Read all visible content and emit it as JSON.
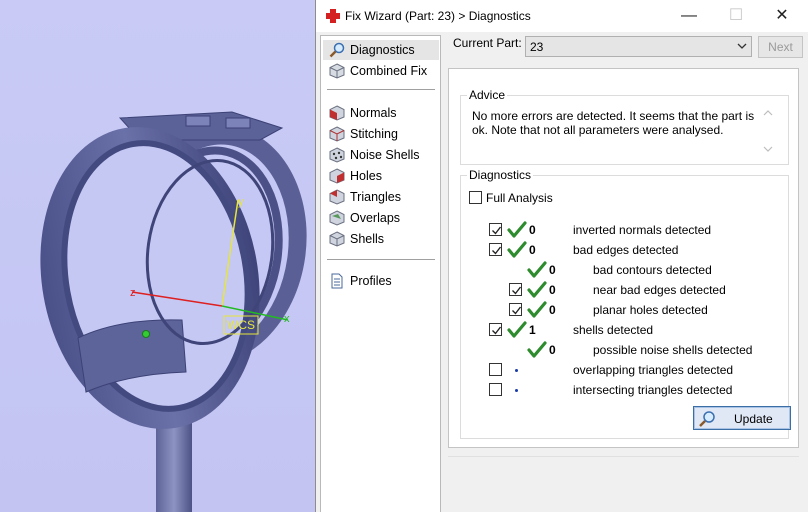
{
  "window": {
    "title": "Fix Wizard (Part: 23) > Diagnostics",
    "minimize": "—",
    "maximize": "☐",
    "close": "✕"
  },
  "nav": {
    "items": [
      {
        "label": "Diagnostics",
        "icon": "magnifier-icon",
        "selected": true
      },
      {
        "label": "Combined Fix",
        "icon": "cube-icon"
      },
      {
        "label": "Normals",
        "icon": "normals-cube-icon"
      },
      {
        "label": "Stitching",
        "icon": "stitching-cube-icon"
      },
      {
        "label": "Noise Shells",
        "icon": "noise-shells-icon"
      },
      {
        "label": "Holes",
        "icon": "holes-cube-icon"
      },
      {
        "label": "Triangles",
        "icon": "triangles-cube-icon"
      },
      {
        "label": "Overlaps",
        "icon": "overlaps-cube-icon"
      },
      {
        "label": "Shells",
        "icon": "shells-cube-icon"
      },
      {
        "label": "Profiles",
        "icon": "document-icon"
      }
    ]
  },
  "current_part": {
    "label": "Current Part:",
    "value": "23",
    "next_label": "Next"
  },
  "advice": {
    "title": "Advice",
    "text": "No more errors are detected. It seems that the part is ok. Note that not all parameters were analysed."
  },
  "diagnostics": {
    "title": "Diagnostics",
    "full_analysis_label": "Full Analysis",
    "full_analysis_checked": false,
    "rows": [
      {
        "checkbox": true,
        "checked": true,
        "status": "ok",
        "count": "0",
        "label": "inverted normals detected",
        "indent": 0
      },
      {
        "checkbox": true,
        "checked": true,
        "status": "ok",
        "count": "0",
        "label": "bad edges detected",
        "indent": 0
      },
      {
        "checkbox": false,
        "checked": false,
        "status": "ok",
        "count": "0",
        "label": "bad contours detected",
        "indent": 1
      },
      {
        "checkbox": true,
        "checked": true,
        "status": "ok",
        "count": "0",
        "label": "near bad edges detected",
        "indent": 1
      },
      {
        "checkbox": true,
        "checked": true,
        "status": "ok",
        "count": "0",
        "label": "planar holes detected",
        "indent": 1
      },
      {
        "checkbox": true,
        "checked": true,
        "status": "ok",
        "count": "1",
        "label": "shells detected",
        "indent": 0
      },
      {
        "checkbox": false,
        "checked": false,
        "status": "ok",
        "count": "0",
        "label": "possible noise shells detected",
        "indent": 1
      },
      {
        "checkbox": true,
        "checked": false,
        "status": "dot",
        "count": "",
        "label": "overlapping triangles detected",
        "indent": 0
      },
      {
        "checkbox": true,
        "checked": false,
        "status": "dot",
        "count": "",
        "label": "intersecting triangles detected",
        "indent": 0
      }
    ],
    "update_label": "Update"
  },
  "viewport": {
    "wcs_label": "WCS",
    "axis_y": "y",
    "axis_z": "z",
    "axis_x": "x"
  },
  "colors": {
    "check_green": "#2e8b2e",
    "part_fill": "#5b6298",
    "background": "#c7c8f3"
  }
}
